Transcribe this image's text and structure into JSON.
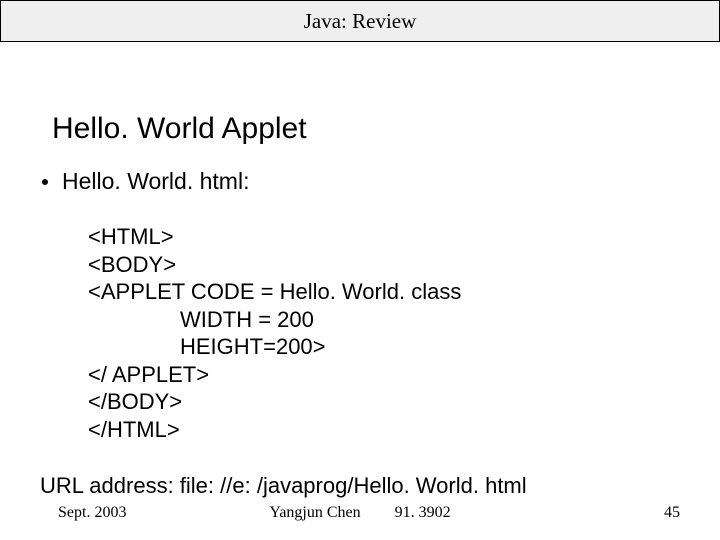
{
  "banner": {
    "title": "Java: Review"
  },
  "slide": {
    "title": "Hello. World Applet",
    "bullet": "Hello. World. html:",
    "code": {
      "l1": "<HTML>",
      "l2": "<BODY>",
      "l3": "<APPLET CODE = Hello. World. class",
      "l4": "WIDTH = 200",
      "l5": "HEIGHT=200>",
      "l6": "</ APPLET>",
      "l7": "</BODY>",
      "l8": "</HTML>"
    },
    "url_line": "URL address: file: //e: /javaprog/Hello. World. html"
  },
  "footer": {
    "date": "Sept. 2003",
    "author": "Yangjun Chen",
    "course": "91. 3902",
    "page": "45"
  }
}
